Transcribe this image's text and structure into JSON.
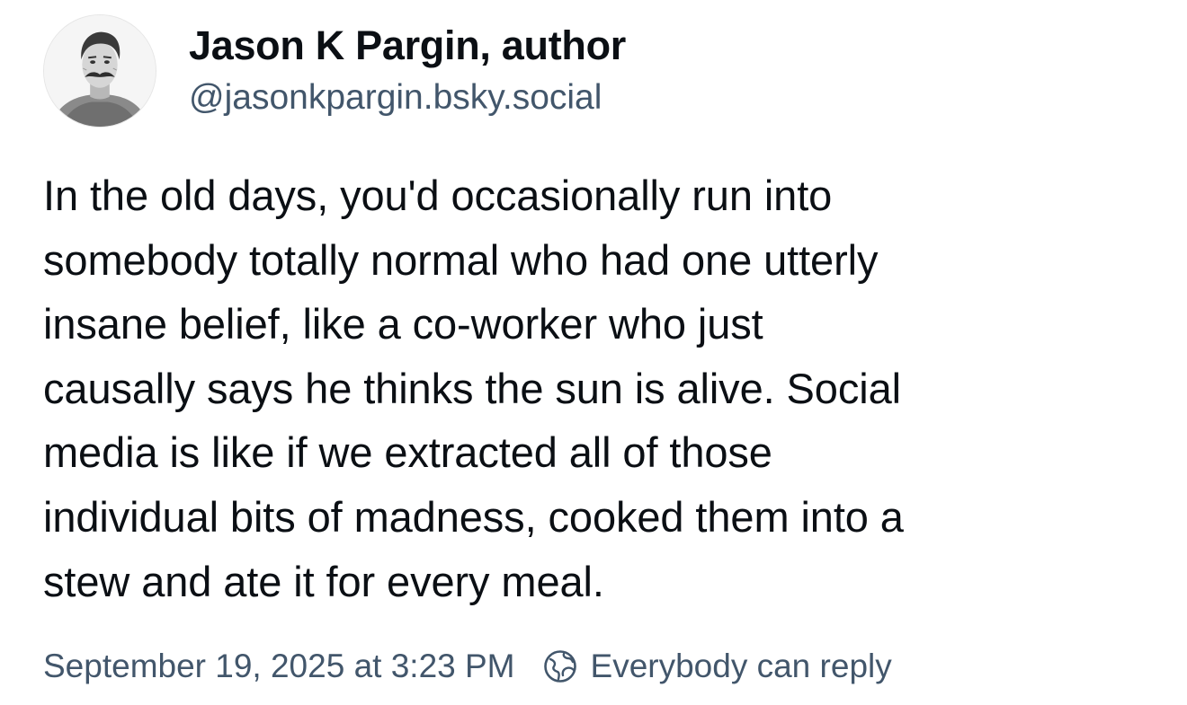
{
  "author": {
    "display_name": "Jason K Pargin, author",
    "handle": "@jasonkpargin.bsky.social",
    "avatar_icon": "avatar-portrait"
  },
  "post": {
    "text": "In the old days, you'd occasionally run into\nsomebody totally normal who had one utterly\ninsane belief, like a co-worker who just\ncausally says he thinks the sun is alive. Social\nmedia is like if we extracted all of those\nindividual bits of madness, cooked them into a\nstew and ate it for every meal."
  },
  "meta": {
    "timestamp": "September 19, 2025 at 3:23 PM",
    "reply_setting_icon": "globe-icon",
    "reply_setting": "Everybody can reply"
  },
  "colors": {
    "text": "#0b0f14",
    "muted": "#42566b",
    "background": "#ffffff"
  }
}
